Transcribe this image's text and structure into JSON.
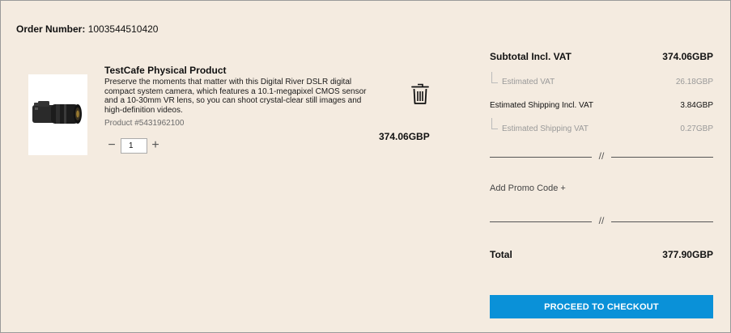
{
  "order": {
    "label": "Order Number:",
    "number": "1003544510420"
  },
  "product": {
    "title": "TestCafe Physical Product",
    "description": "Preserve the moments that matter with this Digital River DSLR digital compact system camera, which features a 10.1-megapixel CMOS sensor and a 10-30mm VR lens, so you can shoot crystal-clear still images and high-definition videos.",
    "sku": "Product #5431962100",
    "image_icon": "camera-product-image",
    "quantity": "1",
    "minus_symbol": "−",
    "plus_symbol": "+",
    "delete_icon": "trash-icon",
    "line_price": "374.06GBP"
  },
  "summary": {
    "subtotal_label": "Subtotal Incl. VAT",
    "subtotal_value": "374.06GBP",
    "estimated_vat_label": "Estimated VAT",
    "estimated_vat_value": "26.18GBP",
    "shipping_label": "Estimated Shipping Incl. VAT",
    "shipping_value": "3.84GBP",
    "shipping_vat_label": "Estimated Shipping VAT",
    "shipping_vat_value": "0.27GBP",
    "divider_symbol": "//",
    "promo_label": "Add Promo Code +",
    "total_label": "Total",
    "total_value": "377.90GBP",
    "checkout_label": "PROCEED TO CHECKOUT"
  },
  "colors": {
    "background": "#f4ebe0",
    "checkout_button": "#0a91d8"
  }
}
